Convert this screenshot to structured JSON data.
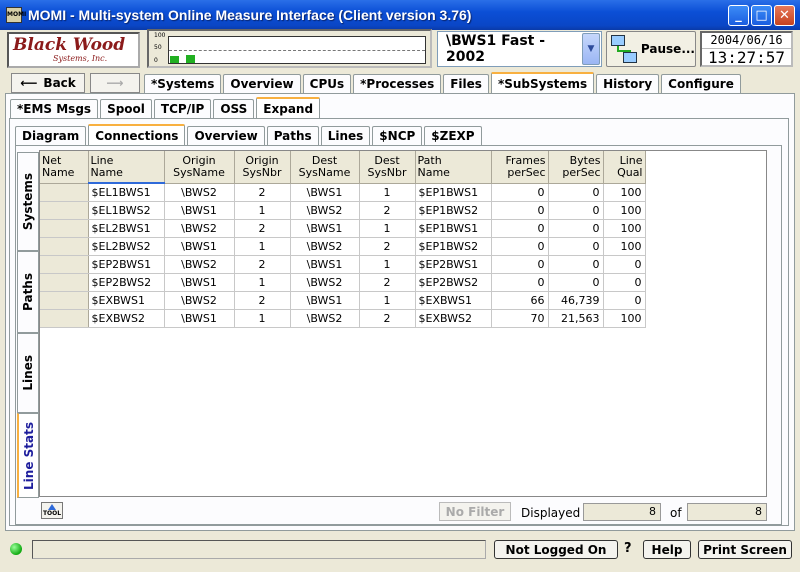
{
  "window": {
    "title": "MOMI - Multi-system Online Measure Interface (Client version 3.76)",
    "app_icon_label": "MOMI",
    "minimize": "_",
    "maximize": "□",
    "close": "✕"
  },
  "header": {
    "logo_line1": "Black Wood",
    "logo_line2": "Systems, Inc.",
    "graph_labels": [
      "100",
      "50",
      "0"
    ],
    "graph_bars": [
      0.25,
      0.3
    ],
    "system": "\\BWS1 Fast - 2002",
    "pause_label": "Pause...",
    "date": "2004/06/16",
    "time": "13:27:57"
  },
  "nav": {
    "back": "Back",
    "main_tabs": [
      "*Systems",
      "Overview",
      "CPUs",
      "*Processes",
      "Files",
      "*SubSystems",
      "History",
      "Configure"
    ],
    "main_active": 5,
    "sub_tabs": [
      "*EMS Msgs",
      "Spool",
      "TCP/IP",
      "OSS",
      "Expand"
    ],
    "sub_active": 4,
    "third_tabs": [
      "Diagram",
      "Connections",
      "Overview",
      "Paths",
      "Lines",
      "$NCP",
      "$ZEXP"
    ],
    "third_active": 1,
    "side_tabs": [
      "Systems",
      "Paths",
      "Lines",
      "Line Stats"
    ],
    "side_active": 3
  },
  "table": {
    "headers": [
      [
        "Net",
        "Name"
      ],
      [
        "Line",
        "Name"
      ],
      [
        "Origin",
        "SysName"
      ],
      [
        "Origin",
        "SysNbr"
      ],
      [
        "Dest",
        "SysName"
      ],
      [
        "Dest",
        "SysNbr"
      ],
      [
        "Path",
        "Name"
      ],
      [
        "Frames",
        "perSec"
      ],
      [
        "Bytes",
        "perSec"
      ],
      [
        "Line",
        "Qual"
      ]
    ],
    "rows": [
      [
        "",
        "$EL1BWS1",
        "\\BWS2",
        "2",
        "\\BWS1",
        "1",
        "$EP1BWS1",
        "0",
        "0",
        "100"
      ],
      [
        "",
        "$EL1BWS2",
        "\\BWS1",
        "1",
        "\\BWS2",
        "2",
        "$EP1BWS2",
        "0",
        "0",
        "100"
      ],
      [
        "",
        "$EL2BWS1",
        "\\BWS2",
        "2",
        "\\BWS1",
        "1",
        "$EP1BWS1",
        "0",
        "0",
        "100"
      ],
      [
        "",
        "$EL2BWS2",
        "\\BWS1",
        "1",
        "\\BWS2",
        "2",
        "$EP1BWS2",
        "0",
        "0",
        "100"
      ],
      [
        "",
        "$EP2BWS1",
        "\\BWS2",
        "2",
        "\\BWS1",
        "1",
        "$EP2BWS1",
        "0",
        "0",
        "0"
      ],
      [
        "",
        "$EP2BWS2",
        "\\BWS1",
        "1",
        "\\BWS2",
        "2",
        "$EP2BWS2",
        "0",
        "0",
        "0"
      ],
      [
        "",
        "$EXBWS1",
        "\\BWS2",
        "2",
        "\\BWS1",
        "1",
        "$EXBWS1",
        "66",
        "46,739",
        "0"
      ],
      [
        "",
        "$EXBWS2",
        "\\BWS1",
        "1",
        "\\BWS2",
        "2",
        "$EXBWS2",
        "70",
        "21,563",
        "100"
      ]
    ]
  },
  "footer": {
    "tool_label": "TOOL",
    "no_filter": "No Filter",
    "displayed_label": "Displayed",
    "displayed_count": "8",
    "of_label": "of",
    "total_count": "8"
  },
  "status": {
    "login": "Not Logged On",
    "question": "?",
    "help": "Help",
    "print": "Print Screen"
  }
}
